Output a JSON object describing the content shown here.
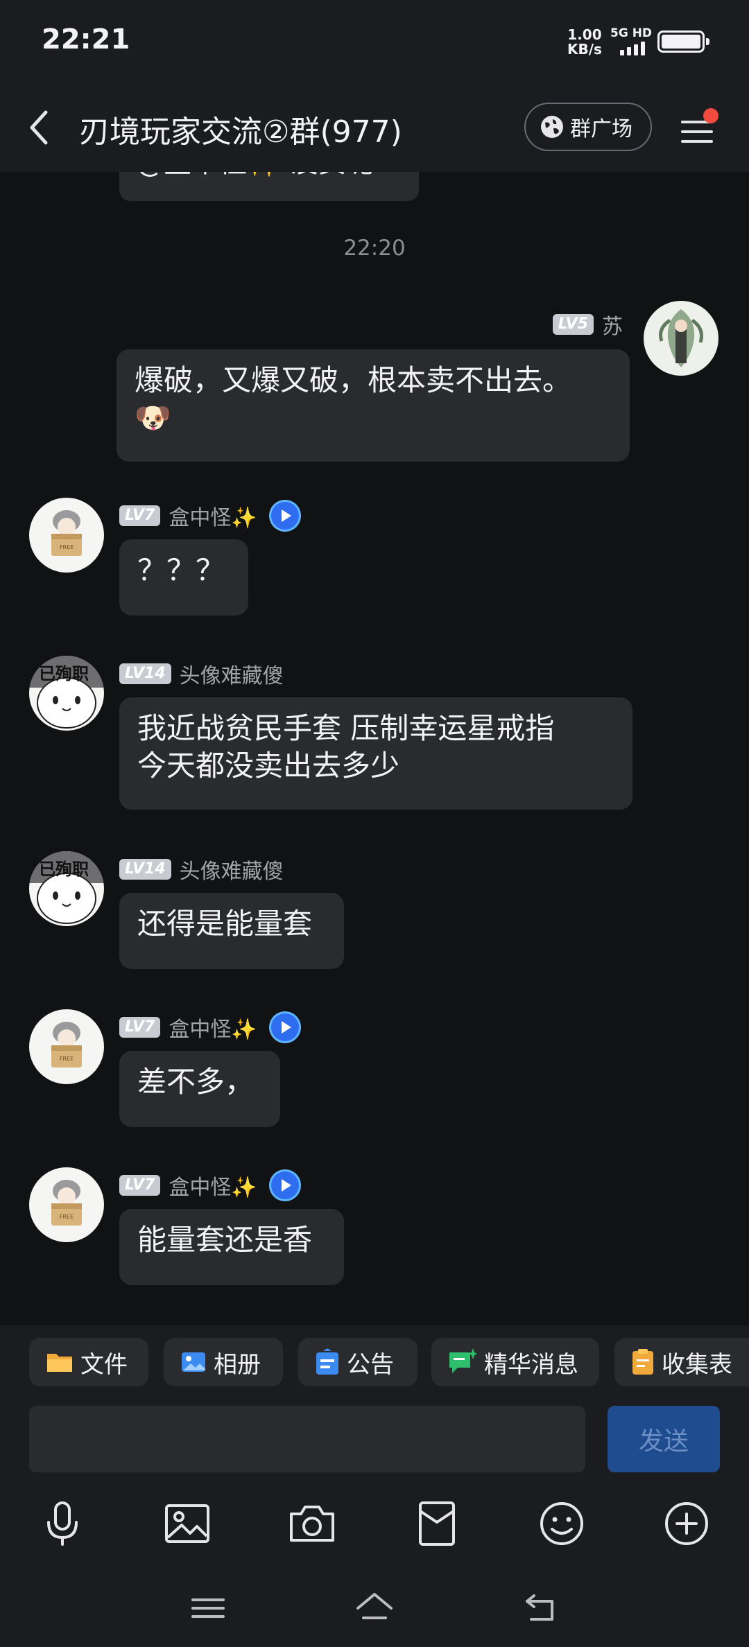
{
  "status_bar": {
    "time": "22:21",
    "net_speed_value": "1.00",
    "net_speed_unit": "KB/s",
    "network": "5G HD"
  },
  "header": {
    "title": "刃境玩家交流②群(977)",
    "square_button": "群广场"
  },
  "chat": {
    "partial_text": "@盒中怪✨ 没卖呢",
    "timestamp": "22:20",
    "messages": [
      {
        "level": "LV5",
        "name": "苏",
        "text": "爆破，又爆又破，根本卖不出去。\n🐶"
      },
      {
        "level": "LV7",
        "name": "盒中怪✨",
        "text": "？？？"
      },
      {
        "level": "LV14",
        "name": "头像难藏傻",
        "avatar_text": "已殉职",
        "text": "我近战贫民手套 压制幸运星戒指\n今天都没卖出去多少"
      },
      {
        "level": "LV14",
        "name": "头像难藏傻",
        "avatar_text": "已殉职",
        "text": "还得是能量套"
      },
      {
        "level": "LV7",
        "name": "盒中怪✨",
        "text": "差不多，"
      },
      {
        "level": "LV7",
        "name": "盒中怪✨",
        "text": "能量套还是香"
      }
    ]
  },
  "toolbar": {
    "chips": [
      "文件",
      "相册",
      "公告",
      "精华消息",
      "收集表"
    ],
    "input_placeholder": "",
    "send_label": "发送",
    "icons": [
      "microphone-icon",
      "image-icon",
      "camera-icon",
      "red-packet-icon",
      "emoji-icon",
      "plus-circle-icon"
    ]
  },
  "colors": {
    "background": "#111214",
    "bar": "#1b1c1f",
    "bubble": "#2a2b2f",
    "send": "#1f4b8f",
    "badge": "#f04b3e"
  }
}
